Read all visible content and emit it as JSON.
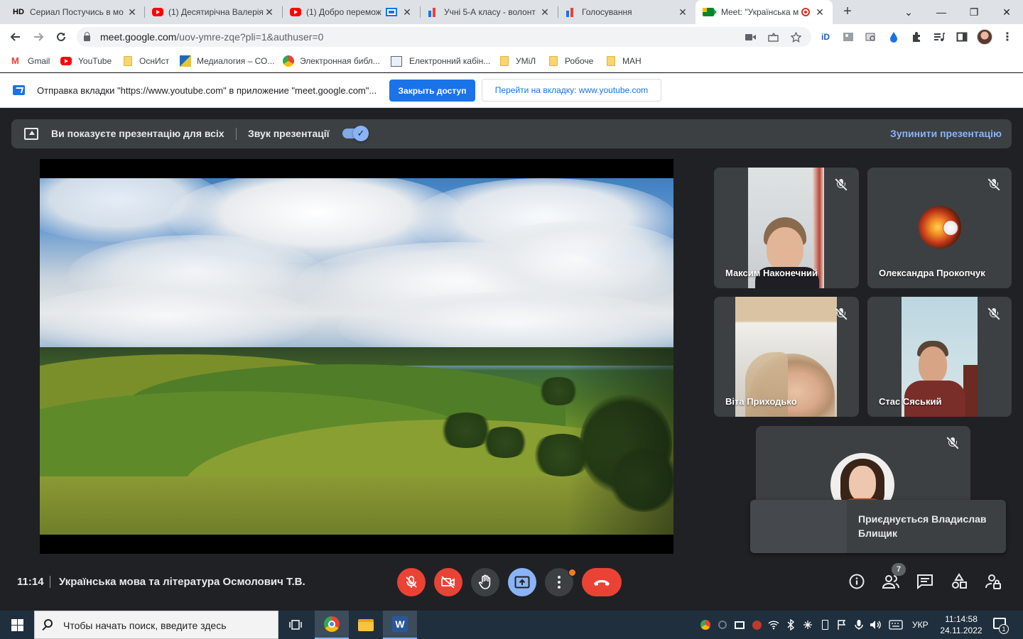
{
  "browser": {
    "tabs": [
      {
        "favicon": "hd-text",
        "prefix": "HD",
        "title": "Сериал Постучись в мо"
      },
      {
        "favicon": "youtube-icon",
        "title": "(1) Десятирічна Валерія"
      },
      {
        "favicon": "youtube-icon",
        "title": "(1) Добро перемож"
      },
      {
        "favicon": "chart-icon",
        "title": "Учні 5-А класу - волонт"
      },
      {
        "favicon": "chart-icon",
        "title": "Голосування"
      },
      {
        "favicon": "meet-icon",
        "title": "Meet: \"Українська м",
        "active": true
      }
    ],
    "new_tab": "+",
    "window_controls": {
      "down": "⌄",
      "minimize": "—",
      "restore": "❐",
      "close": "✕"
    }
  },
  "address": {
    "host": "meet.google.com",
    "path": "/uov-ymre-zqe?pli=1&authuser=0"
  },
  "bookmarks": [
    {
      "icon": "gmail-icon",
      "label": "Gmail"
    },
    {
      "icon": "youtube-icon",
      "label": "YouTube"
    },
    {
      "icon": "folder-icon",
      "label": "ОснИст"
    },
    {
      "icon": "site-icon",
      "label": "Медиалогия – СО..."
    },
    {
      "icon": "chrome-icon",
      "label": "Электронная библ..."
    },
    {
      "icon": "page-icon",
      "label": "Електронний кабін..."
    },
    {
      "icon": "folder-icon",
      "label": "УМіЛ"
    },
    {
      "icon": "folder-icon",
      "label": "Робоче"
    },
    {
      "icon": "folder-icon",
      "label": "МАН"
    }
  ],
  "infobar": {
    "text": "Отправка вкладки \"https://www.youtube.com\" в приложение \"meet.google.com\"...",
    "primary_button": "Закрыть доступ",
    "secondary_button": "Перейти на вкладку: www.youtube.com"
  },
  "presenting": {
    "status": "Ви показуєте презентацію для всіх",
    "audio_label": "Звук презентації",
    "audio_enabled": true,
    "stop_label": "Зупинити презентацію"
  },
  "participants": [
    {
      "name": "Максим Наконечний",
      "muted": true
    },
    {
      "name": "Олександра Прокопчук",
      "muted": true
    },
    {
      "name": "Віта Приходько",
      "muted": true
    },
    {
      "name": "Стас Сяський",
      "muted": true
    },
    {
      "name": "",
      "muted": true
    }
  ],
  "join_notice": "Приєднується Владислав Блищик",
  "callbar": {
    "time": "11:14",
    "meeting_title": "Українська мова та література Осмолович Т.В.",
    "mic_on": false,
    "camera_on": false,
    "people_count": "7"
  },
  "taskbar": {
    "search_placeholder": "Чтобы начать поиск, введите здесь",
    "language": "УКР",
    "time": "11:14:58",
    "date": "24.11.2022",
    "notifications": "1"
  },
  "colors": {
    "meet_bg": "#202124",
    "tile_bg": "#3c4043",
    "accent_blue": "#8ab4f8",
    "danger_red": "#ea4335",
    "chrome_blue": "#1a73e8"
  }
}
